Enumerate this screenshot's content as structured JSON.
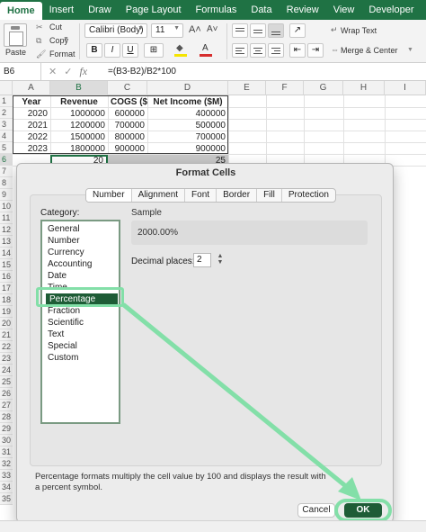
{
  "ribbon": {
    "tabs": [
      "Home",
      "Insert",
      "Draw",
      "Page Layout",
      "Formulas",
      "Data",
      "Review",
      "View",
      "Developer"
    ],
    "active_tab": "Home"
  },
  "toolbar": {
    "paste_label": "Paste",
    "cut_label": "Cut",
    "copy_label": "Copy",
    "format_label": "Format",
    "font_name": "Calibri (Body)",
    "font_size": "11",
    "bold": "B",
    "italic": "I",
    "underline": "U",
    "wrap_text_label": "Wrap Text",
    "merge_center_label": "Merge & Center"
  },
  "formula_bar": {
    "name_box": "B6",
    "fx_label": "fx",
    "formula": "=(B3-B2)/B2*100"
  },
  "sheet": {
    "columns": [
      "A",
      "B",
      "C",
      "D",
      "E",
      "F",
      "G",
      "H",
      "I"
    ],
    "rows": [
      "1",
      "2",
      "3",
      "4",
      "5",
      "6",
      "7",
      "8",
      "9",
      "10",
      "11",
      "12",
      "13",
      "14",
      "15",
      "16",
      "17",
      "18",
      "19",
      "20",
      "21",
      "22",
      "23",
      "24",
      "25",
      "26",
      "27",
      "28",
      "29",
      "30",
      "31",
      "32",
      "33",
      "34",
      "35"
    ],
    "header_row": {
      "a": "Year",
      "b": "Revenue",
      "c": "COGS ($M)",
      "d": "Net Income ($M)"
    },
    "data_rows": [
      {
        "a": "2020",
        "b": "1000000",
        "c": "600000",
        "d": "400000"
      },
      {
        "a": "2021",
        "b": "1200000",
        "c": "700000",
        "d": "500000"
      },
      {
        "a": "2022",
        "b": "1500000",
        "c": "800000",
        "d": "700000"
      },
      {
        "a": "2023",
        "b": "1800000",
        "c": "900000",
        "d": "900000"
      }
    ],
    "row6": {
      "b": "20",
      "d": "25"
    }
  },
  "dialog": {
    "title": "Format Cells",
    "tabs": [
      "Number",
      "Alignment",
      "Font",
      "Border",
      "Fill",
      "Protection"
    ],
    "active_tab": "Number",
    "category_label": "Category:",
    "categories": [
      "General",
      "Number",
      "Currency",
      "Accounting",
      "Date",
      "Time",
      "Percentage",
      "Fraction",
      "Scientific",
      "Text",
      "Special",
      "Custom"
    ],
    "selected_category": "Percentage",
    "sample_label": "Sample",
    "sample_value": "2000.00%",
    "decimal_label": "Decimal places:",
    "decimal_value": "2",
    "description": "Percentage formats multiply the cell value by 100 and displays the result with a percent symbol.",
    "cancel_label": "Cancel",
    "ok_label": "OK"
  },
  "annotation": {
    "color": "#83dfa8"
  }
}
